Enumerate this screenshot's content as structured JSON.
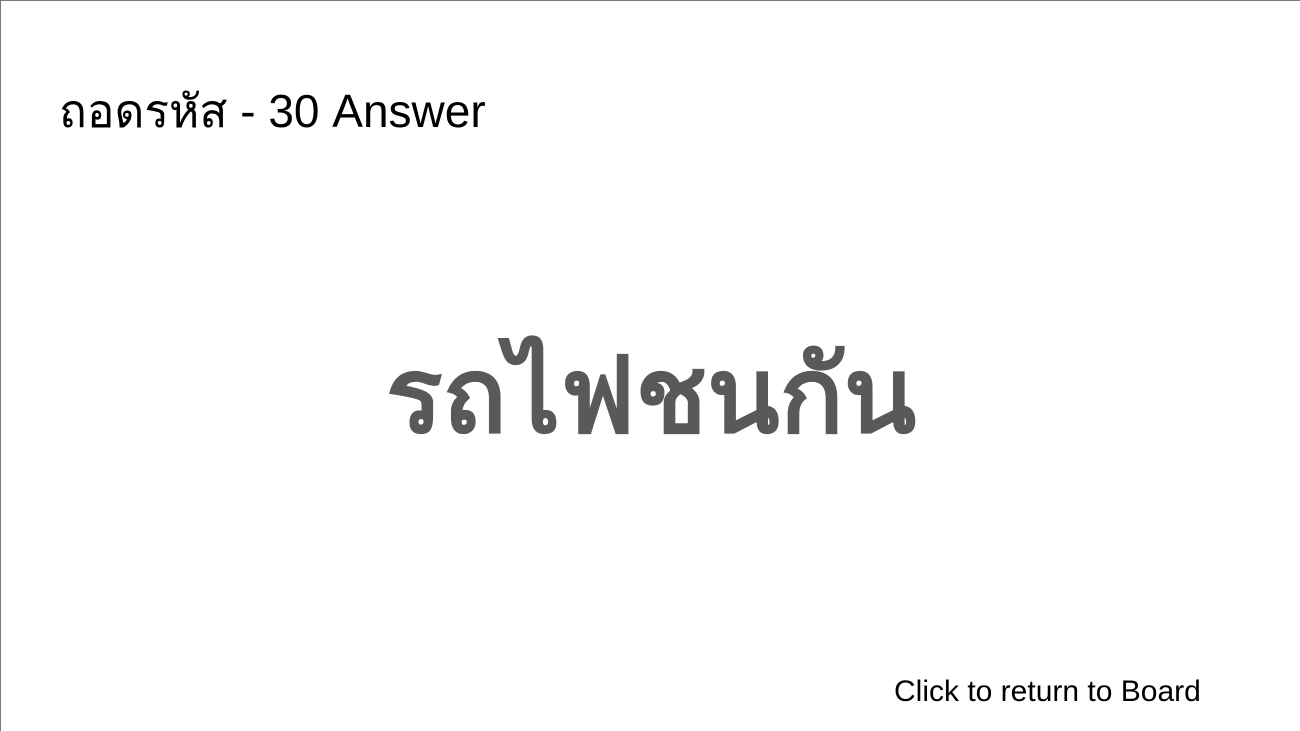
{
  "slide": {
    "title": "ถอดรหัส - 30 Answer",
    "answer": "รถไฟชนกัน",
    "return_link": "Click to return to Board"
  },
  "colors": {
    "background": "#ffffff",
    "title_text": "#000000",
    "answer_text": "#595959",
    "border": "#7a7a7a"
  }
}
